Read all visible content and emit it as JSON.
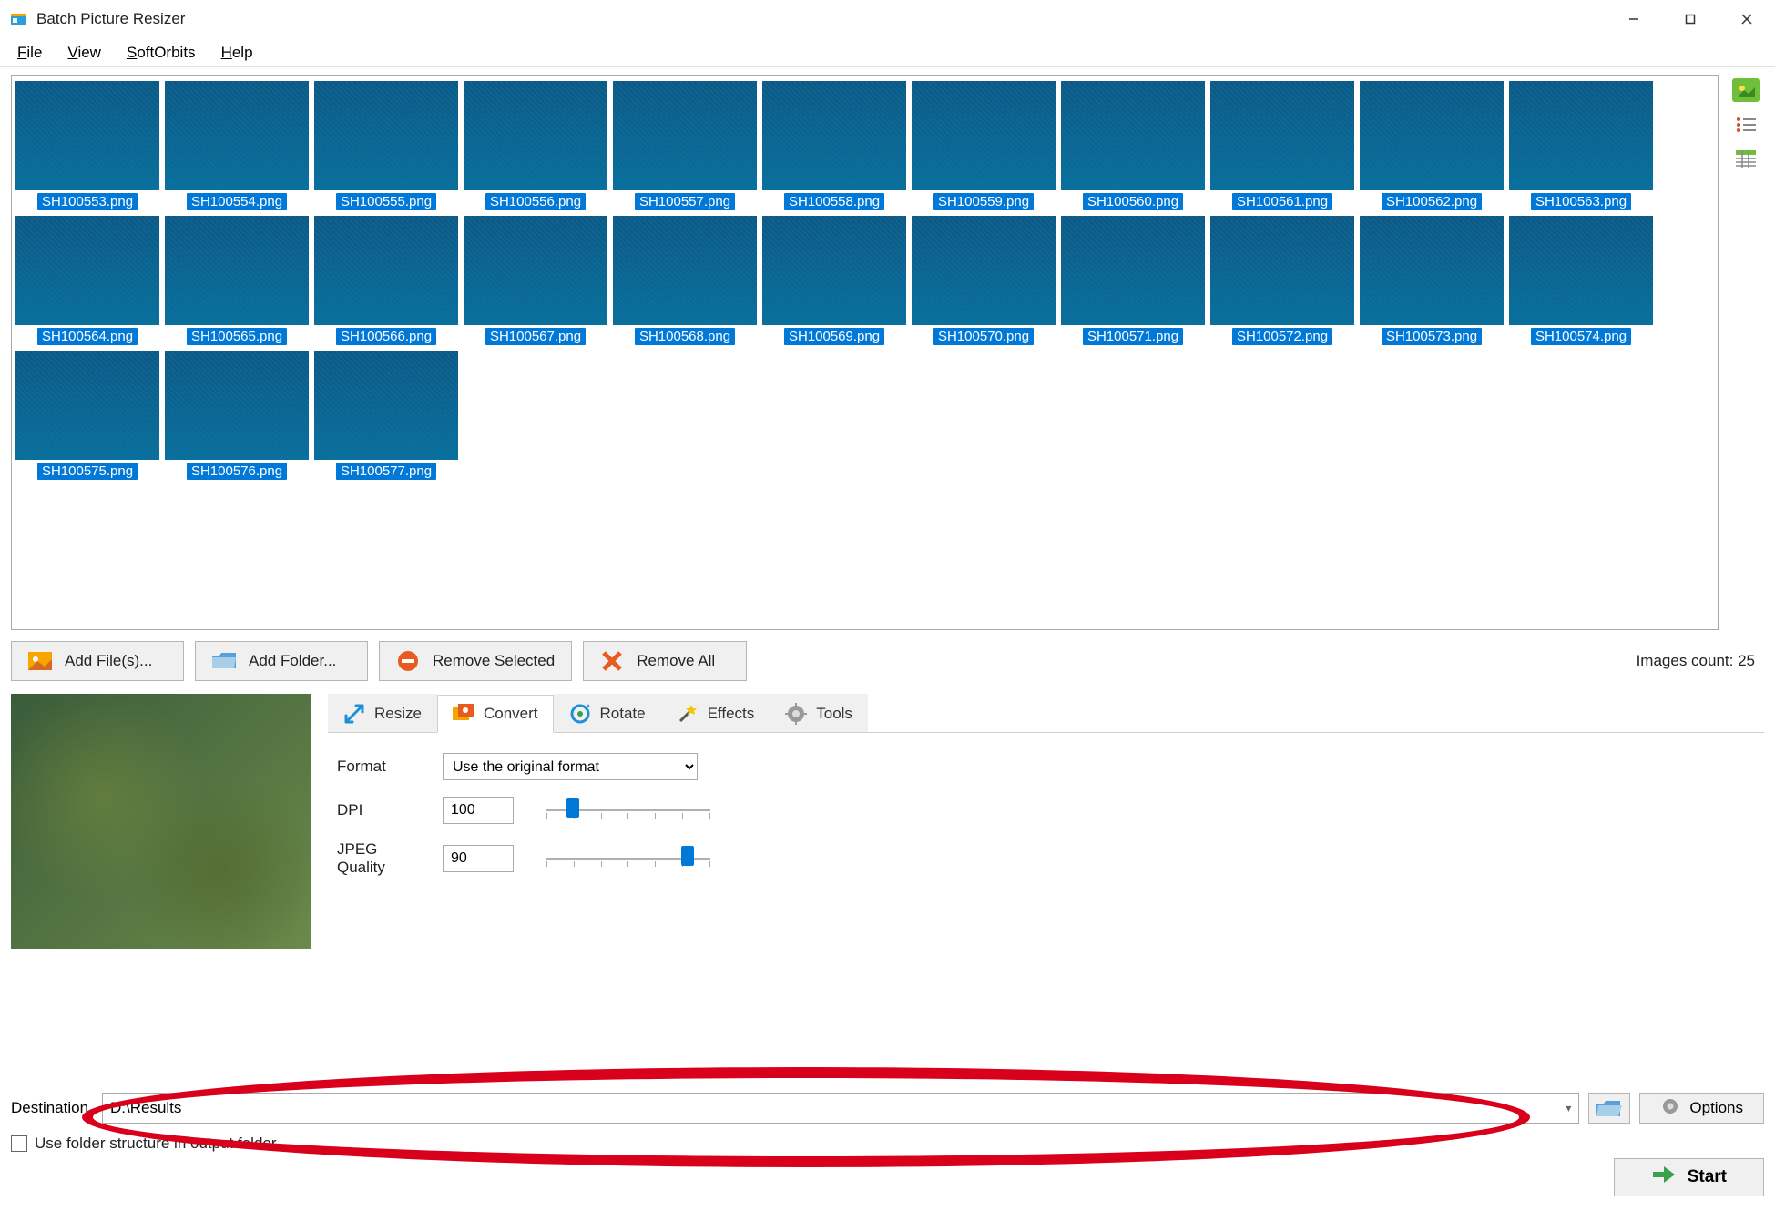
{
  "window": {
    "title": "Batch Picture Resizer"
  },
  "menu": {
    "file": "File",
    "view": "View",
    "softorbits": "SoftOrbits",
    "help": "Help"
  },
  "thumbnails": [
    "SH100553.png",
    "SH100554.png",
    "SH100555.png",
    "SH100556.png",
    "SH100557.png",
    "SH100558.png",
    "SH100559.png",
    "SH100560.png",
    "SH100561.png",
    "SH100562.png",
    "SH100563.png",
    "SH100564.png",
    "SH100565.png",
    "SH100566.png",
    "SH100567.png",
    "SH100568.png",
    "SH100569.png",
    "SH100570.png",
    "SH100571.png",
    "SH100572.png",
    "SH100573.png",
    "SH100574.png",
    "SH100575.png",
    "SH100576.png",
    "SH100577.png"
  ],
  "toolbar": {
    "add_files": "Add File(s)...",
    "add_folder": "Add Folder...",
    "remove_selected": "Remove Selected",
    "remove_all": "Remove All",
    "count_label": "Images count: 25"
  },
  "tabs": {
    "resize": "Resize",
    "convert": "Convert",
    "rotate": "Rotate",
    "effects": "Effects",
    "tools": "Tools"
  },
  "convert": {
    "format_label": "Format",
    "format_value": "Use the original format",
    "dpi_label": "DPI",
    "dpi_value": "100",
    "jpeg_label": "JPEG Quality",
    "jpeg_value": "90"
  },
  "dest": {
    "label": "Destination",
    "value": "D:\\Results",
    "folder_structure": "Use folder structure in output folder",
    "options": "Options",
    "start": "Start"
  }
}
